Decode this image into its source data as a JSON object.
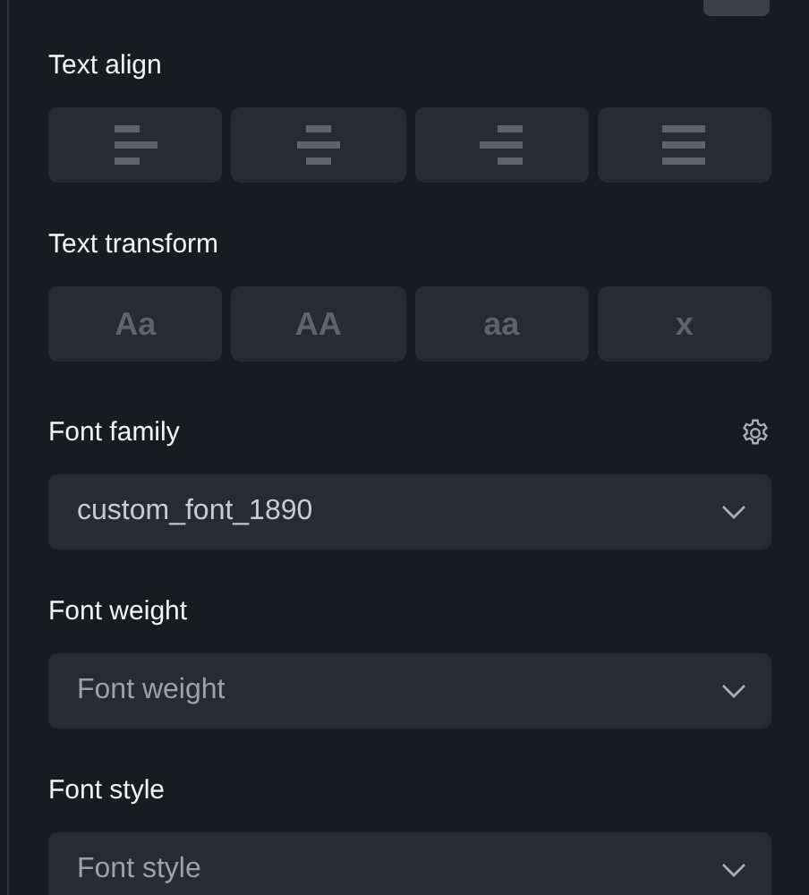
{
  "text_align": {
    "label": "Text align",
    "options": [
      {
        "kind": "left"
      },
      {
        "kind": "center"
      },
      {
        "kind": "right"
      },
      {
        "kind": "justify"
      }
    ]
  },
  "text_transform": {
    "label": "Text transform",
    "options": [
      {
        "label": "Aa"
      },
      {
        "label": "AA"
      },
      {
        "label": "aa"
      },
      {
        "label": "x"
      }
    ]
  },
  "fields": [
    {
      "label": "Font family",
      "settings": true,
      "value": "custom_font_1890"
    },
    {
      "label": "Font weight",
      "settings": false,
      "placeholder": "Font weight"
    },
    {
      "label": "Font style",
      "settings": false,
      "placeholder": "Font style"
    }
  ]
}
